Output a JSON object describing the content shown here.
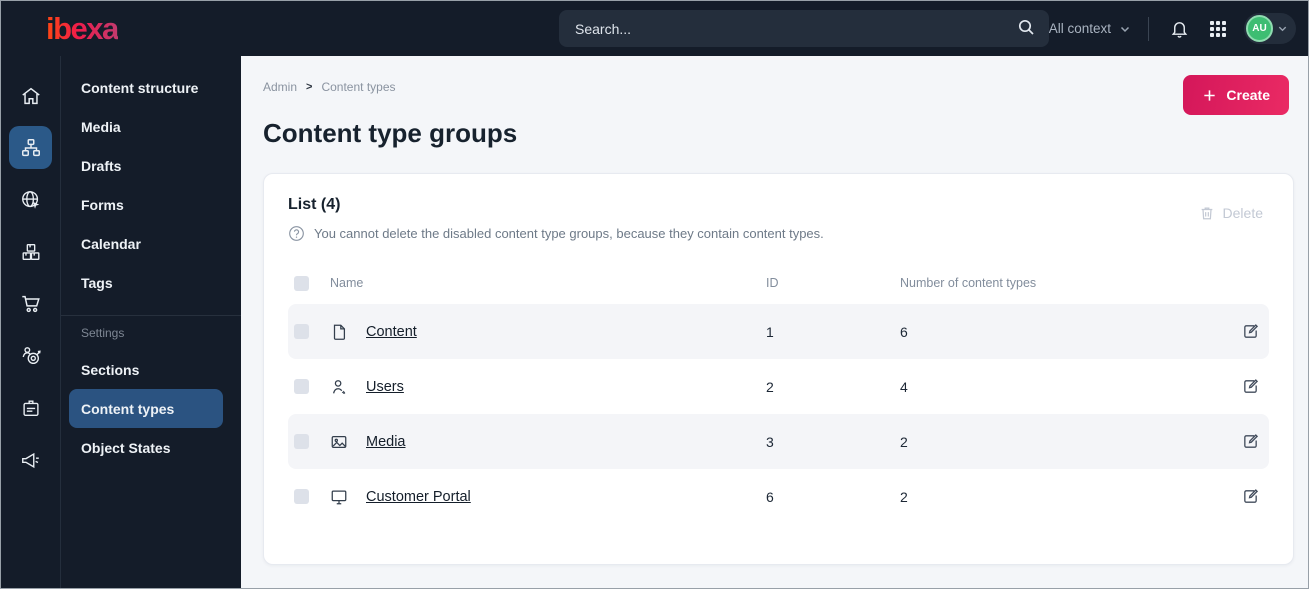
{
  "topbar": {
    "logo": "ibexa",
    "search": {
      "placeholder": "Search..."
    },
    "site_switcher": {
      "label": "Site: All context"
    },
    "avatar": {
      "initials": "AU"
    }
  },
  "sidebar": {
    "rail_icons": [
      "home-icon",
      "content-structure-icon",
      "site-icon",
      "commerce-icon",
      "cart-icon",
      "personalization-icon",
      "admin-badge-icon",
      "announcement-icon"
    ],
    "main_items": [
      {
        "label": "Content structure"
      },
      {
        "label": "Media"
      },
      {
        "label": "Drafts"
      },
      {
        "label": "Forms"
      },
      {
        "label": "Calendar"
      },
      {
        "label": "Tags"
      }
    ],
    "settings": {
      "heading": "Settings",
      "items": [
        {
          "label": "Sections"
        },
        {
          "label": "Content types"
        },
        {
          "label": "Object States"
        }
      ],
      "active_item": "Content types"
    }
  },
  "breadcrumb": {
    "items": [
      "Admin",
      "Content types"
    ],
    "separator": ">"
  },
  "page": {
    "title": "Content type groups",
    "create_button": "Create"
  },
  "panel": {
    "list_title": "List (4)",
    "help_text": "You cannot delete the disabled content type groups, because they contain content types.",
    "delete_button": "Delete",
    "table": {
      "columns": [
        "Name",
        "ID",
        "Number of content types"
      ],
      "rows": [
        {
          "icon": "file-icon",
          "name": "Content",
          "id": "1",
          "content_types_count": "6"
        },
        {
          "icon": "user-icon",
          "name": "Users",
          "id": "2",
          "content_types_count": "4"
        },
        {
          "icon": "image-icon",
          "name": "Media",
          "id": "3",
          "content_types_count": "2"
        },
        {
          "icon": "monitor-icon",
          "name": "Customer Portal",
          "id": "6",
          "content_types_count": "2"
        }
      ]
    }
  },
  "colors": {
    "topbar_bg": "#141c29",
    "active_blue": "#2b5988",
    "brand_gradient_start": "#ff4713",
    "brand_gradient_end": "#c23a6e",
    "button_gradient_start": "#d4175a",
    "button_gradient_end": "#ea2a64",
    "avatar_green": "#3dbd72",
    "page_bg": "#f4f6f9",
    "zebra_row_bg": "#f4f5f8"
  }
}
